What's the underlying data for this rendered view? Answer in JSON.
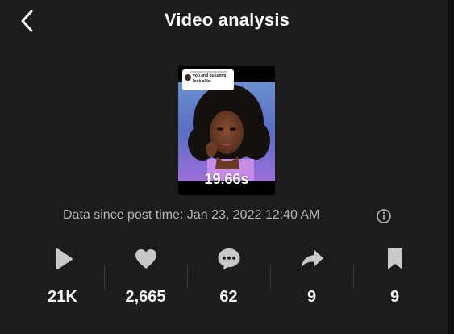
{
  "header": {
    "title": "Video analysis",
    "back_icon": "chevron-left-icon"
  },
  "video": {
    "duration": "19.66s",
    "caption": "you and bukunmi look alike"
  },
  "data_since": "Data since post time: Jan 23, 2022 12:40 AM",
  "stats": [
    {
      "icon": "play-icon",
      "value": "21K"
    },
    {
      "icon": "heart-icon",
      "value": "2,665"
    },
    {
      "icon": "comment-icon",
      "value": "62"
    },
    {
      "icon": "share-icon",
      "value": "9"
    },
    {
      "icon": "bookmark-icon",
      "value": "9"
    }
  ],
  "colors": {
    "background": "#1c1c1c",
    "icon": "#c8c8c8",
    "secondary_text": "#b6b6b6",
    "primary_text": "#ffffff"
  }
}
